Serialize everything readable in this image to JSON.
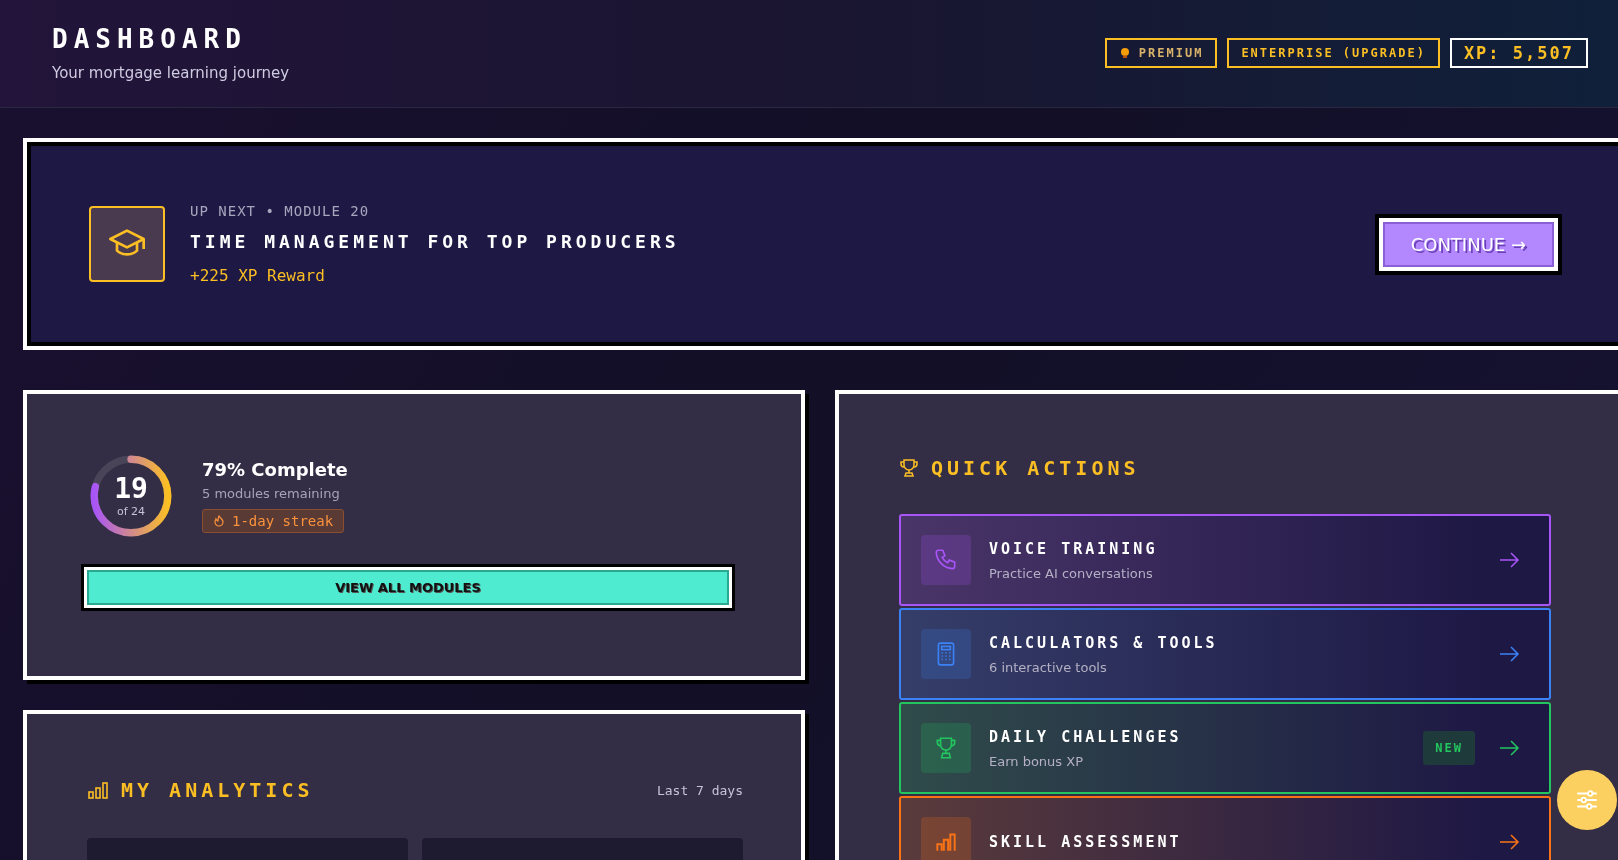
{
  "header": {
    "title": "DASHBOARD",
    "subtitle": "Your mortgage learning journey",
    "badges": [
      {
        "label": "PREMIUM",
        "kind": "plan"
      },
      {
        "label": "ENTERPRISE (UPGRADE)",
        "kind": "upgrade"
      },
      {
        "label": "XP: 5,507",
        "kind": "xp"
      }
    ]
  },
  "up_next": {
    "eyebrow": "UP NEXT • MODULE 20",
    "title": "TIME MANAGEMENT FOR TOP PRODUCERS",
    "reward": "+225 XP Reward",
    "button": "CONTINUE →"
  },
  "progress": {
    "count": "19",
    "total": "of 24",
    "level": 0.79,
    "headline": "79% Complete",
    "remaining": "5 modules remaining",
    "streak": "1-day streak",
    "button": "VIEW ALL MODULES"
  },
  "analytics": {
    "title": "MY ANALYTICS",
    "range": "Last 7 days"
  },
  "quick_actions": {
    "title": "QUICK ACTIONS",
    "items": [
      {
        "title": "VOICE TRAINING",
        "subtitle": "Practice AI conversations",
        "color": "#a855f7"
      },
      {
        "title": "CALCULATORS & TOOLS",
        "subtitle": "6 interactive tools",
        "color": "#3b82f6"
      },
      {
        "title": "DAILY CHALLENGES",
        "subtitle": "Earn bonus XP",
        "color": "#22c55e",
        "badge": "NEW"
      },
      {
        "title": "SKILL ASSESSMENT",
        "color": "#f97316"
      }
    ]
  }
}
